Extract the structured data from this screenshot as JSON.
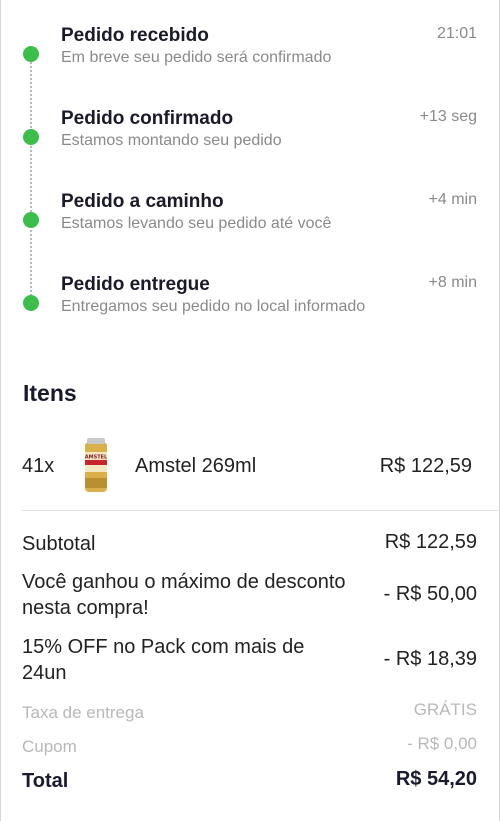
{
  "timeline": [
    {
      "title": "Pedido recebido",
      "subtitle": "Em breve seu pedido será confirmado",
      "time": "21:01"
    },
    {
      "title": "Pedido confirmado",
      "subtitle": "Estamos montando seu pedido",
      "time": "+13 seg"
    },
    {
      "title": "Pedido a caminho",
      "subtitle": "Estamos levando seu pedido até você",
      "time": "+4 min"
    },
    {
      "title": "Pedido entregue",
      "subtitle": "Entregamos seu pedido no local informado",
      "time": "+8 min"
    }
  ],
  "items_section": {
    "heading": "Itens",
    "items": [
      {
        "qty": "41x",
        "name": "Amstel 269ml",
        "price": "R$ 122,59",
        "image_icon": "beer-can-icon",
        "image_text": "AMSTEL"
      }
    ]
  },
  "summary": {
    "subtotal_label": "Subtotal",
    "subtotal_value": "R$ 122,59",
    "discount_label": "Você ganhou o máximo de desconto nesta compra!",
    "discount_value": "- R$ 50,00",
    "pack_label": "15% OFF no Pack com mais de 24un",
    "pack_value": "- R$ 18,39",
    "delivery_label": "Taxa de entrega",
    "delivery_value": "GRÁTIS",
    "coupon_label": "Cupom",
    "coupon_value": "- R$ 0,00",
    "total_label": "Total",
    "total_value": "R$ 54,20"
  },
  "colors": {
    "status_dot": "#3cbf4a",
    "muted_text": "#8a8a8a",
    "heading_text": "#1a1a2e"
  }
}
